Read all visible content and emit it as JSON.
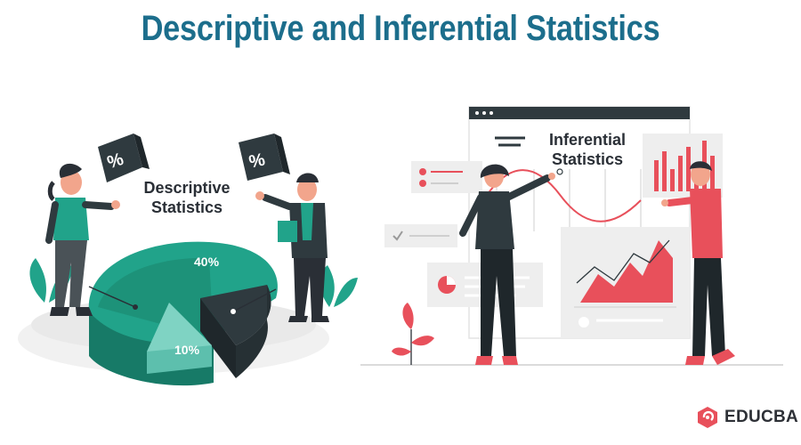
{
  "title": "Descriptive and Inferential Statistics",
  "left": {
    "label_line1": "Descriptive",
    "label_line2": "Statistics",
    "pie_top_percent": "40%",
    "pie_slice_percent": "10%",
    "badge_symbol": "%"
  },
  "right": {
    "label_line1": "Inferential",
    "label_line2": "Statistics"
  },
  "brand": {
    "name": "EDUCBA"
  },
  "colors": {
    "title": "#1c6e8c",
    "teal": "#21a38a",
    "teal_dark": "#177a67",
    "teal_light": "#7fd3c3",
    "dark_slate": "#2f3a3f",
    "accent_red": "#e8505b"
  },
  "icons": [
    "percent-badge-icon",
    "pie-chart-icon",
    "line-chart-icon",
    "bar-chart-icon",
    "plant-icon",
    "educba-logo-icon"
  ]
}
